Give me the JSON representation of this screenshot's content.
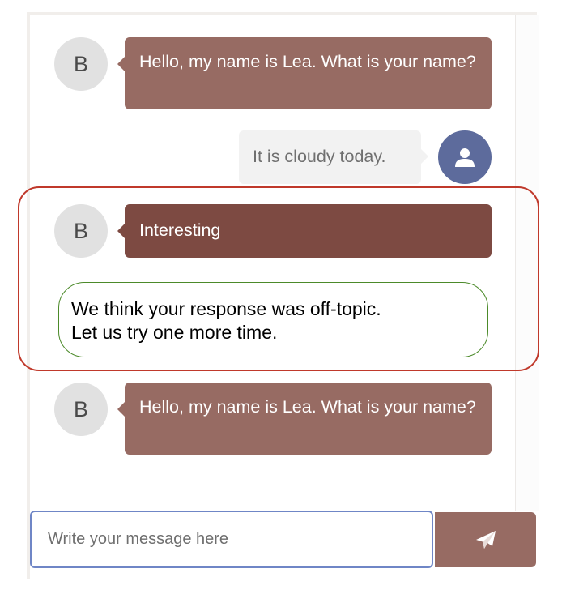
{
  "messages": [
    {
      "sender": "bot",
      "avatar_letter": "B",
      "text": "Hello, my name is Lea. What is your name?"
    },
    {
      "sender": "user",
      "avatar_icon": "user-icon",
      "text": "It is cloudy today."
    },
    {
      "sender": "bot",
      "avatar_letter": "B",
      "text": "Interesting"
    },
    {
      "sender": "bot",
      "avatar_letter": "B",
      "text": "Hello, my name is Lea. What is your name?"
    }
  ],
  "feedback": {
    "line1": "We think your response was off-topic.",
    "line2": "Let us try one more time."
  },
  "composer": {
    "placeholder": "Write your message here",
    "send_icon": "paper-plane-icon"
  },
  "colors": {
    "bot_bubble": "#976b63",
    "bot_bubble_active": "#7d4a42",
    "user_bubble": "#f2f2f2",
    "user_avatar": "#5d6b9c",
    "highlight_border": "#c0392b",
    "feedback_border": "#4c8a2a",
    "input_border": "#6f86c6"
  }
}
